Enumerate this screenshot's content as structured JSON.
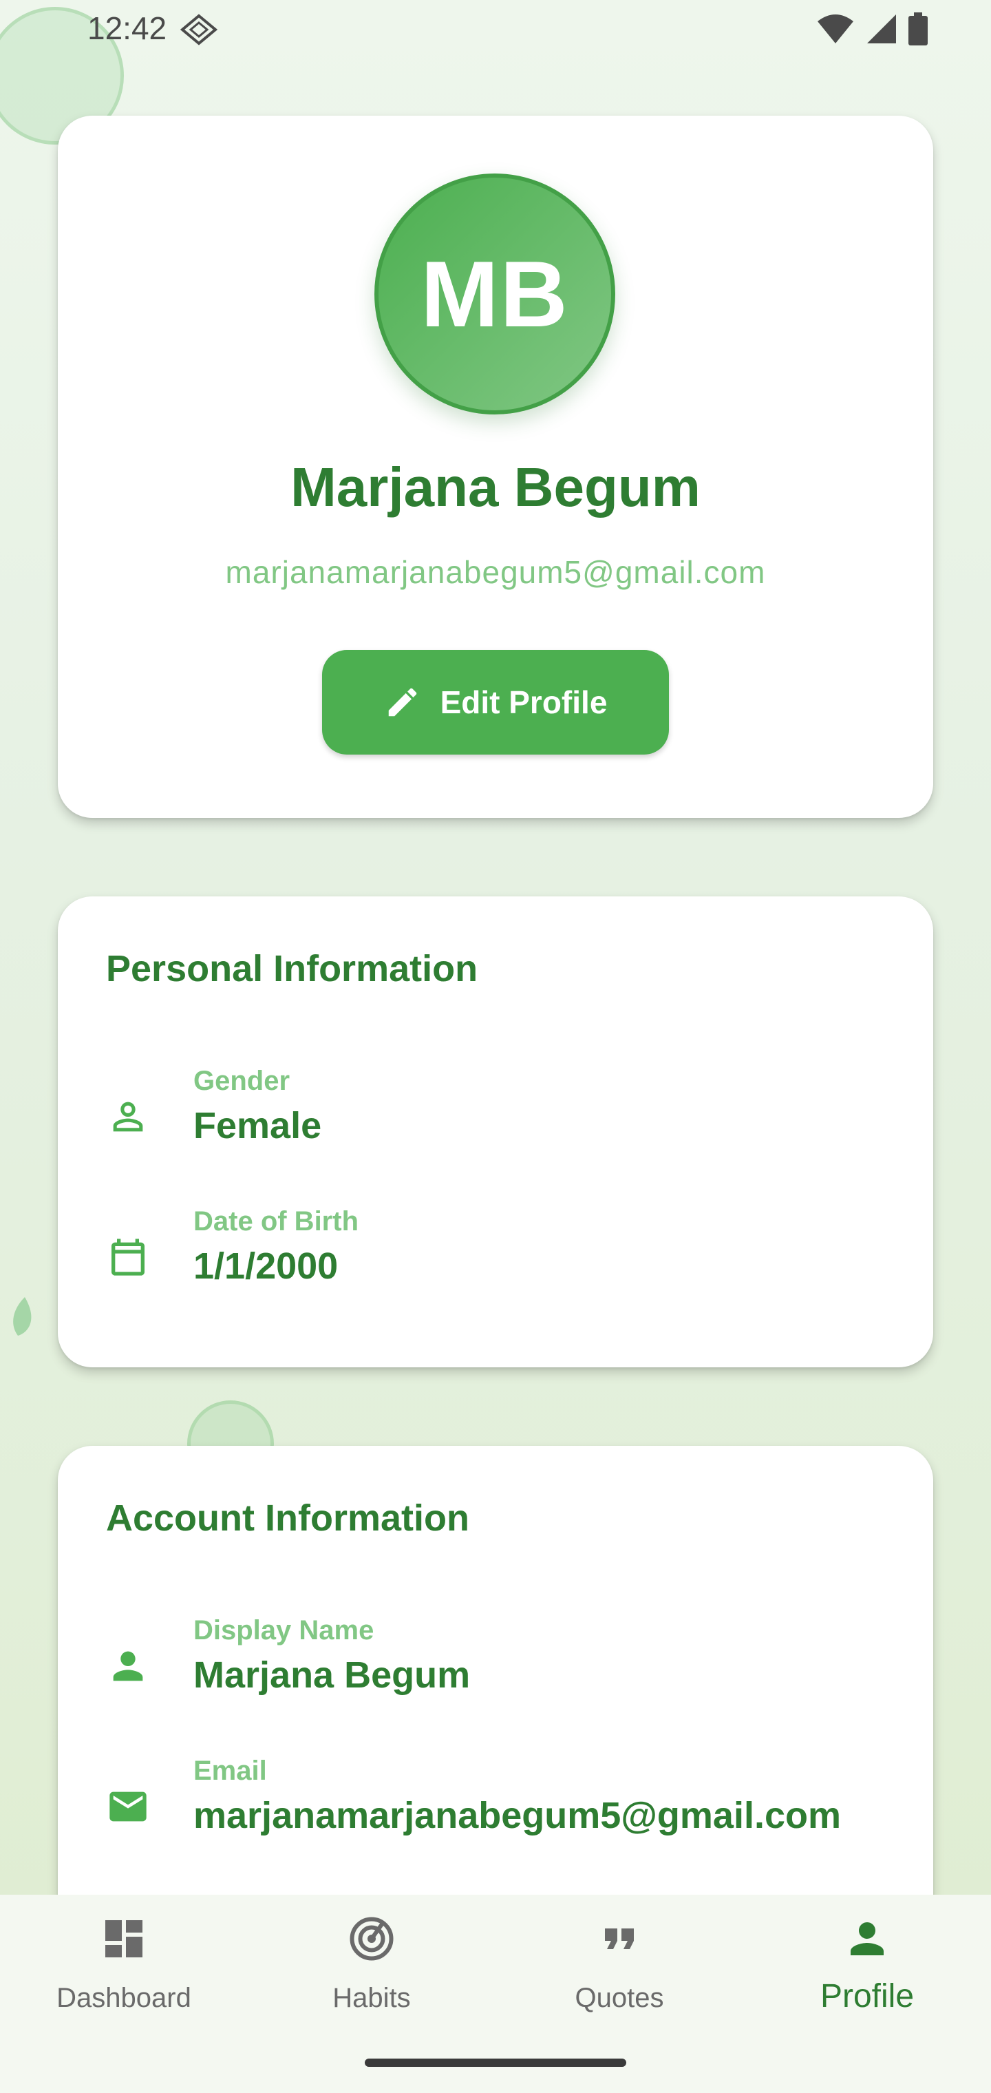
{
  "status_bar": {
    "time": "12:42"
  },
  "profile": {
    "initials": "MB",
    "name": "Marjana Begum",
    "email": "marjanamarjanabegum5@gmail.com",
    "edit_label": "Edit Profile"
  },
  "personal": {
    "title": "Personal Information",
    "rows": [
      {
        "label": "Gender",
        "value": "Female",
        "icon": "person-outline-icon"
      },
      {
        "label": "Date of Birth",
        "value": "1/1/2000",
        "icon": "calendar-icon"
      }
    ]
  },
  "account": {
    "title": "Account Information",
    "rows": [
      {
        "label": "Display Name",
        "value": "Marjana Begum",
        "icon": "person-icon"
      },
      {
        "label": "Email",
        "value": "marjanamarjanabegum5@gmail.com",
        "icon": "mail-icon"
      }
    ]
  },
  "nav": {
    "active": "Profile",
    "items": [
      {
        "label": "Dashboard",
        "icon": "dashboard-icon"
      },
      {
        "label": "Habits",
        "icon": "habits-icon"
      },
      {
        "label": "Quotes",
        "icon": "quotes-icon"
      },
      {
        "label": "Profile",
        "icon": "profile-icon"
      }
    ]
  },
  "colors": {
    "primary": "#4caf50",
    "dark_green": "#2e7d32",
    "light_green": "#81c784"
  }
}
